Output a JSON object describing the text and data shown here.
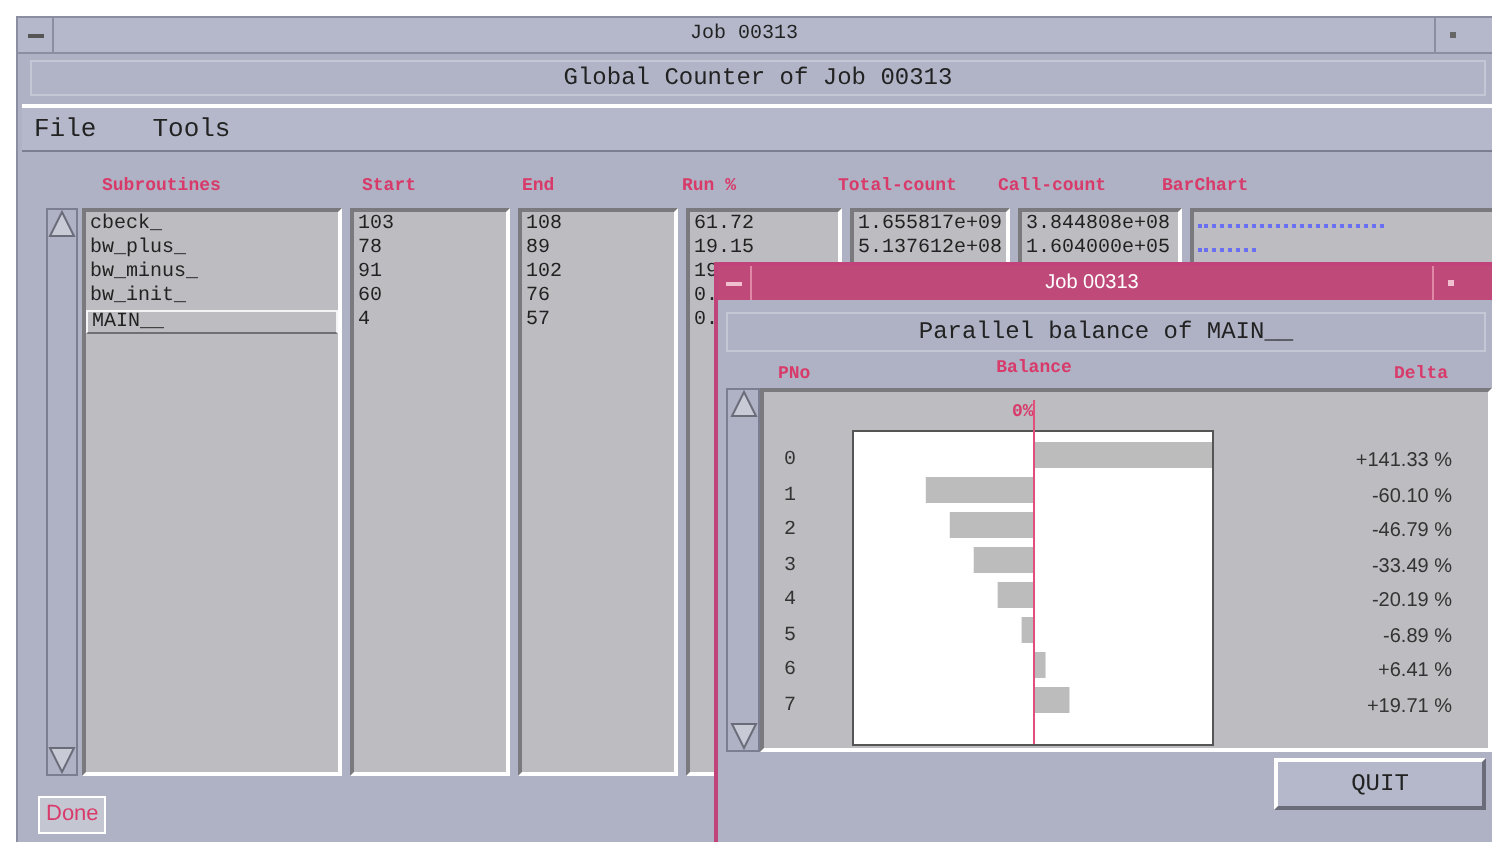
{
  "window": {
    "title": "Job 00313",
    "subtitle": "Global Counter of Job 00313"
  },
  "menu": [
    "File",
    "Tools"
  ],
  "table": {
    "columns": [
      "Subroutines",
      "Start",
      "End",
      "Run %",
      "Total-count",
      "Call-count",
      "BarChart"
    ],
    "rows": [
      {
        "name": "cbeck_",
        "start": "103",
        "end": "108",
        "run": "61.72",
        "total": "1.655817e+09",
        "calls": "3.844808e+08",
        "bar": true,
        "selected": false
      },
      {
        "name": "bw_plus_",
        "start": "78",
        "end": "89",
        "run": "19.15",
        "total": "5.137612e+08",
        "calls": "1.604000e+05",
        "bar": true,
        "selected": false
      },
      {
        "name": "bw_minus_",
        "start": "91",
        "end": "102",
        "run": "19",
        "selected": false
      },
      {
        "name": "bw_init_",
        "start": "60",
        "end": "76",
        "run": "0.",
        "selected": false
      },
      {
        "name": "MAIN__",
        "start": "4",
        "end": "57",
        "run": "0.",
        "selected": true
      }
    ]
  },
  "status": "Done",
  "dialog": {
    "title": "Job 00313",
    "subtitle": "Parallel balance of MAIN__",
    "columns": [
      "PNo",
      "Balance",
      "Delta"
    ],
    "axis_label": "0%",
    "rows": [
      {
        "pno": "0",
        "delta": "+141.33 %"
      },
      {
        "pno": "1",
        "delta": "-60.10 %"
      },
      {
        "pno": "2",
        "delta": "-46.79 %"
      },
      {
        "pno": "3",
        "delta": "-33.49 %"
      },
      {
        "pno": "4",
        "delta": "-20.19 %"
      },
      {
        "pno": "5",
        "delta": "-6.89 %"
      },
      {
        "pno": "6",
        "delta": "+6.41 %"
      },
      {
        "pno": "7",
        "delta": "+19.71 %"
      }
    ],
    "button": "QUIT"
  }
}
